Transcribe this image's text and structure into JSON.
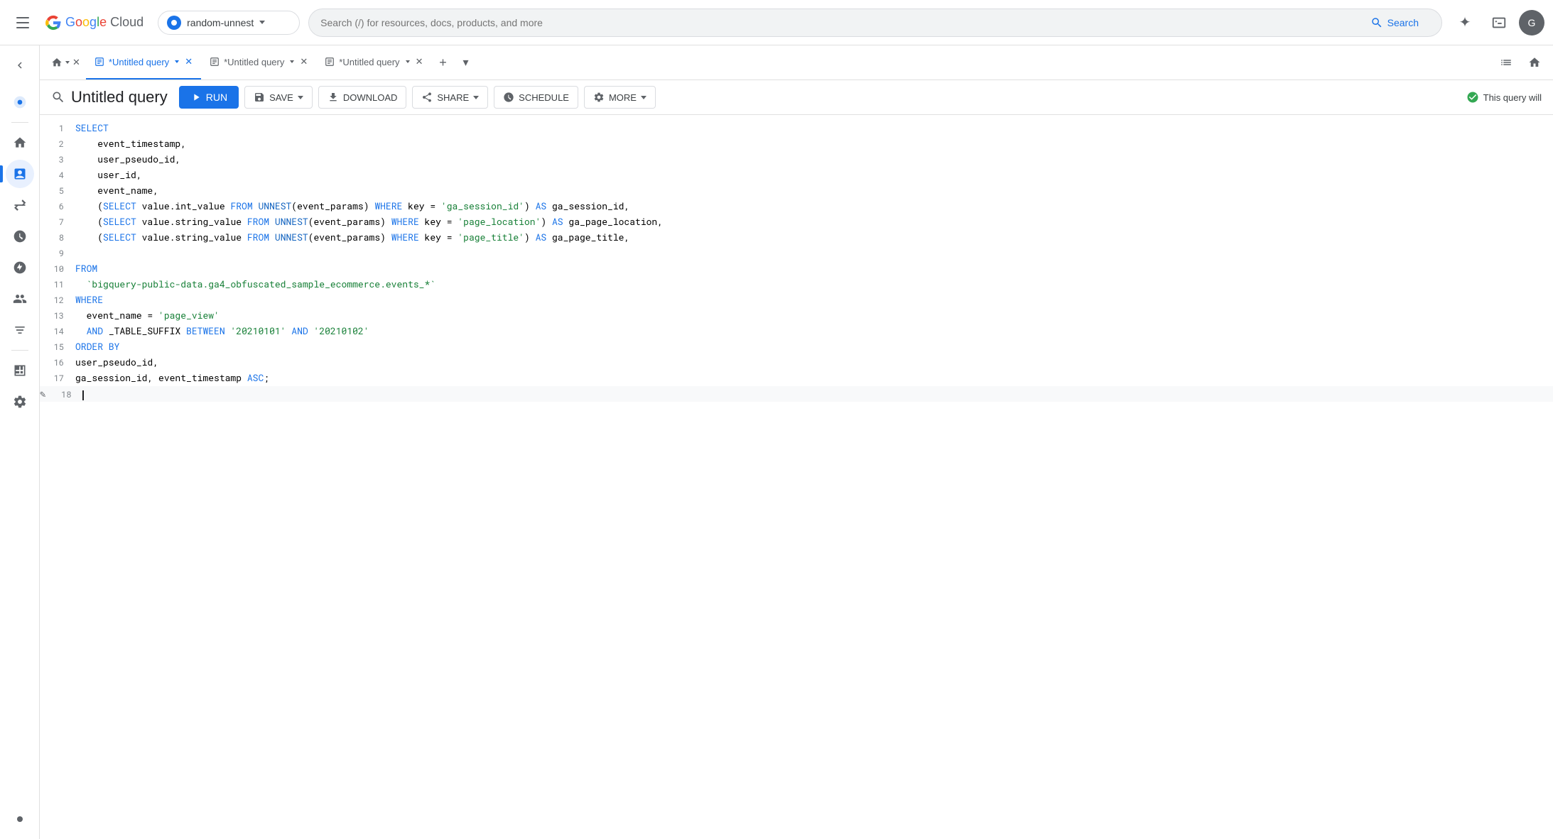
{
  "topNav": {
    "hamburgerLabel": "Menu",
    "logoGoogle": "Google",
    "logoCloud": " Cloud",
    "project": {
      "name": "random-unnest",
      "chevron": "▾"
    },
    "search": {
      "placeholder": "Search (/) for resources, docs, products, and more",
      "buttonLabel": "Search"
    },
    "geminiIcon": "✦",
    "terminalIcon": "⬛"
  },
  "sidebar": {
    "items": [
      {
        "id": "bigquery-logo",
        "icon": "◎",
        "label": "BigQuery",
        "active": false
      },
      {
        "id": "home",
        "icon": "⊙",
        "label": "Home",
        "active": false
      },
      {
        "id": "editor",
        "icon": "▦",
        "label": "SQL Editor",
        "active": true
      },
      {
        "id": "transfers",
        "icon": "⇄",
        "label": "Transfers",
        "active": false
      },
      {
        "id": "scheduled",
        "icon": "◷",
        "label": "Scheduled Queries",
        "active": false
      },
      {
        "id": "analytics-hub",
        "icon": "⊗",
        "label": "Analytics Hub",
        "active": false
      },
      {
        "id": "dataplex",
        "icon": "⚙",
        "label": "Dataplex",
        "active": false
      },
      {
        "id": "spanner",
        "icon": "▾",
        "label": "More",
        "active": false
      },
      {
        "id": "monitoring",
        "icon": "≡",
        "label": "Monitoring",
        "active": false
      },
      {
        "id": "settings",
        "icon": "🔧",
        "label": "Settings",
        "active": false
      }
    ]
  },
  "tabs": [
    {
      "id": "home-tab",
      "label": "Home",
      "icon": "⌂",
      "active": false,
      "closeable": true
    },
    {
      "id": "query-1",
      "label": "*Untitled query",
      "icon": "◧",
      "active": true,
      "closeable": true
    },
    {
      "id": "query-2",
      "label": "*Untitled query",
      "icon": "◧",
      "active": false,
      "closeable": true
    },
    {
      "id": "query-3",
      "label": "*Untitled query",
      "icon": "◧",
      "active": false,
      "closeable": true
    }
  ],
  "queryToolbar": {
    "searchIcon": "⊙",
    "title": "Untitled query",
    "runLabel": "RUN",
    "saveLabel": "SAVE",
    "downloadLabel": "DOWNLOAD",
    "shareLabel": "SHARE",
    "scheduleLabel": "SCHEDULE",
    "moreLabel": "MORE",
    "statusText": "This query will"
  },
  "editor": {
    "lines": [
      {
        "num": 1,
        "tokens": [
          {
            "type": "kw",
            "text": "SELECT"
          }
        ]
      },
      {
        "num": 2,
        "tokens": [
          {
            "type": "col",
            "text": "    event_timestamp,"
          }
        ]
      },
      {
        "num": 3,
        "tokens": [
          {
            "type": "col",
            "text": "    user_pseudo_id,"
          }
        ]
      },
      {
        "num": 4,
        "tokens": [
          {
            "type": "col",
            "text": "    user_id,"
          }
        ]
      },
      {
        "num": 5,
        "tokens": [
          {
            "type": "col",
            "text": "    event_name,"
          }
        ]
      },
      {
        "num": 6,
        "tokens": [
          {
            "type": "punct",
            "text": "    ("
          },
          {
            "type": "kw",
            "text": "SELECT"
          },
          {
            "type": "col",
            "text": " value.int_value "
          },
          {
            "type": "kw",
            "text": "FROM"
          },
          {
            "type": "col",
            "text": " "
          },
          {
            "type": "fn",
            "text": "UNNEST"
          },
          {
            "type": "col",
            "text": "(event_params) "
          },
          {
            "type": "kw",
            "text": "WHERE"
          },
          {
            "type": "col",
            "text": " key = "
          },
          {
            "type": "str",
            "text": "'ga_session_id'"
          },
          {
            "type": "punct",
            "text": ") "
          },
          {
            "type": "kw",
            "text": "AS"
          },
          {
            "type": "col",
            "text": " ga_session_id,"
          }
        ]
      },
      {
        "num": 7,
        "tokens": [
          {
            "type": "punct",
            "text": "    ("
          },
          {
            "type": "kw",
            "text": "SELECT"
          },
          {
            "type": "col",
            "text": " value.string_value "
          },
          {
            "type": "kw",
            "text": "FROM"
          },
          {
            "type": "col",
            "text": " "
          },
          {
            "type": "fn",
            "text": "UNNEST"
          },
          {
            "type": "col",
            "text": "(event_params) "
          },
          {
            "type": "kw",
            "text": "WHERE"
          },
          {
            "type": "col",
            "text": " key = "
          },
          {
            "type": "str",
            "text": "'page_location'"
          },
          {
            "type": "punct",
            "text": ") "
          },
          {
            "type": "kw",
            "text": "AS"
          },
          {
            "type": "col",
            "text": " ga_page_location,"
          }
        ]
      },
      {
        "num": 8,
        "tokens": [
          {
            "type": "punct",
            "text": "    ("
          },
          {
            "type": "kw",
            "text": "SELECT"
          },
          {
            "type": "col",
            "text": " value.string_value "
          },
          {
            "type": "kw",
            "text": "FROM"
          },
          {
            "type": "col",
            "text": " "
          },
          {
            "type": "fn",
            "text": "UNNEST"
          },
          {
            "type": "col",
            "text": "(event_params) "
          },
          {
            "type": "kw",
            "text": "WHERE"
          },
          {
            "type": "col",
            "text": " key = "
          },
          {
            "type": "str",
            "text": "'page_title'"
          },
          {
            "type": "punct",
            "text": ") "
          },
          {
            "type": "kw",
            "text": "AS"
          },
          {
            "type": "col",
            "text": " ga_page_title,"
          }
        ]
      },
      {
        "num": 9,
        "tokens": []
      },
      {
        "num": 10,
        "tokens": [
          {
            "type": "kw",
            "text": "FROM"
          }
        ]
      },
      {
        "num": 11,
        "tokens": [
          {
            "type": "col",
            "text": "  "
          },
          {
            "type": "str",
            "text": "`bigquery-public-data.ga4_obfuscated_sample_ecommerce.events_*`"
          }
        ]
      },
      {
        "num": 12,
        "tokens": [
          {
            "type": "kw",
            "text": "WHERE"
          }
        ]
      },
      {
        "num": 13,
        "tokens": [
          {
            "type": "col",
            "text": "  event_name = "
          },
          {
            "type": "str",
            "text": "'page_view'"
          }
        ]
      },
      {
        "num": 14,
        "tokens": [
          {
            "type": "col",
            "text": "  "
          },
          {
            "type": "kw",
            "text": "AND"
          },
          {
            "type": "col",
            "text": " _TABLE_SUFFIX "
          },
          {
            "type": "kw",
            "text": "BETWEEN"
          },
          {
            "type": "col",
            "text": " "
          },
          {
            "type": "str",
            "text": "'20210101'"
          },
          {
            "type": "col",
            "text": " "
          },
          {
            "type": "kw",
            "text": "AND"
          },
          {
            "type": "col",
            "text": " "
          },
          {
            "type": "str",
            "text": "'20210102'"
          }
        ]
      },
      {
        "num": 15,
        "tokens": [
          {
            "type": "kw",
            "text": "ORDER BY"
          }
        ]
      },
      {
        "num": 16,
        "tokens": [
          {
            "type": "col",
            "text": "user_pseudo_id,"
          }
        ]
      },
      {
        "num": 17,
        "tokens": [
          {
            "type": "col",
            "text": "ga_session_id, event_timestamp "
          },
          {
            "type": "kw",
            "text": "ASC"
          },
          {
            "type": "punct",
            "text": ";"
          }
        ]
      },
      {
        "num": 18,
        "tokens": [],
        "cursor": true
      }
    ]
  }
}
